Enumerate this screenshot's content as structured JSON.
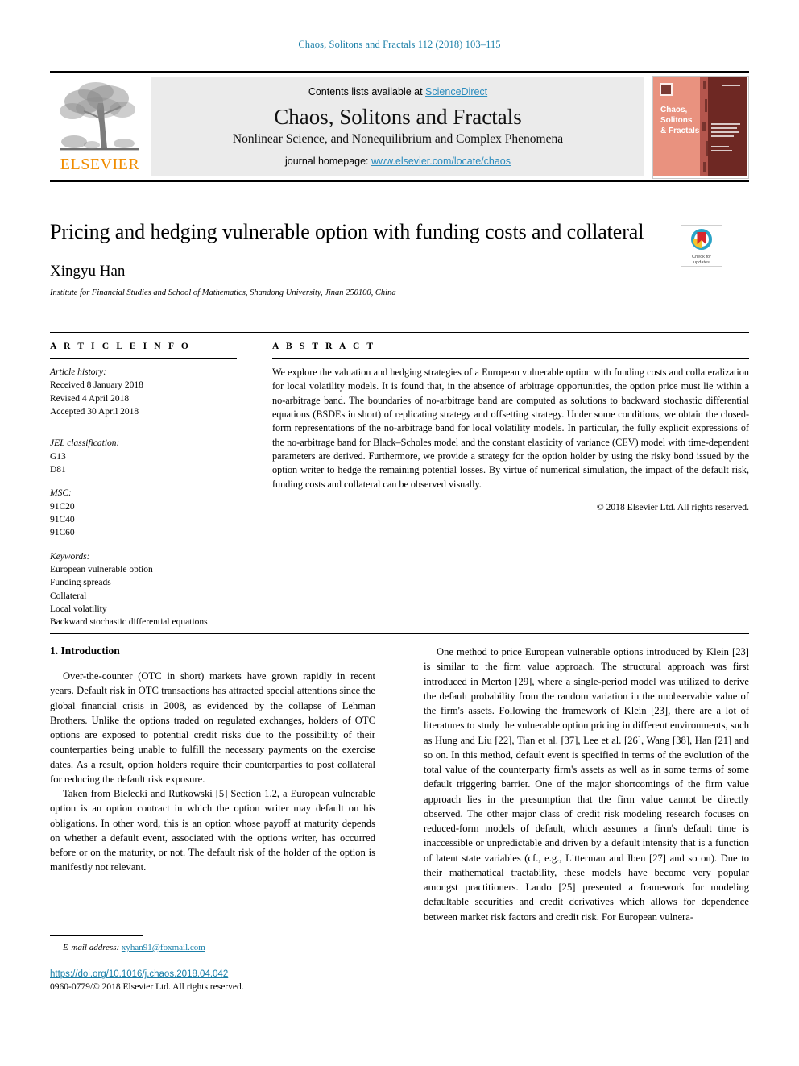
{
  "running_head": "Chaos, Solitons and Fractals 112 (2018) 103–115",
  "masthead": {
    "publisher_name": "ELSEVIER",
    "contents_prefix": "Contents lists available at ",
    "contents_link": "ScienceDirect",
    "journal_title": "Chaos, Solitons and Fractals",
    "journal_subtitle": "Nonlinear Science, and Nonequilibrium and Complex Phenomena",
    "homepage_prefix": "journal homepage: ",
    "homepage_url": "www.elsevier.com/locate/chaos",
    "cover_title_lines": [
      "Chaos,",
      "Solitons",
      "& Fractals"
    ]
  },
  "title_block": {
    "title": "Pricing and hedging vulnerable option with funding costs and collateral",
    "author": "Xingyu Han",
    "affiliation": "Institute for Financial Studies and School of Mathematics, Shandong University, Jinan 250100, China",
    "crossmark_label_line1": "Check for",
    "crossmark_label_line2": "updates"
  },
  "article_info": {
    "heading": "A R T I C L E   I N F O",
    "history_label": "Article history:",
    "history": [
      "Received 8 January 2018",
      "Revised 4 April 2018",
      "Accepted 30 April 2018"
    ],
    "jel_label": "JEL classification:",
    "jel": [
      "G13",
      "D81"
    ],
    "msc_label": "MSC:",
    "msc": [
      "91C20",
      "91C40",
      "91C60"
    ],
    "keywords_label": "Keywords:",
    "keywords": [
      "European vulnerable option",
      "Funding spreads",
      "Collateral",
      "Local volatility",
      "Backward stochastic differential equations"
    ]
  },
  "abstract": {
    "heading": "A B S T R A C T",
    "text": "We explore the valuation and hedging strategies of a European vulnerable option with funding costs and collateralization for local volatility models. It is found that, in the absence of arbitrage opportunities, the option price must lie within a no-arbitrage band. The boundaries of no-arbitrage band are computed as solutions to backward stochastic differential equations (BSDEs in short) of replicating strategy and offsetting strategy. Under some conditions, we obtain the closed-form representations of the no-arbitrage band for local volatility models. In particular, the fully explicit expressions of the no-arbitrage band for Black–Scholes model and the constant elasticity of variance (CEV) model with time-dependent parameters are derived. Furthermore, we provide a strategy for the option holder by using the risky bond issued by the option writer to hedge the remaining potential losses. By virtue of numerical simulation, the impact of the default risk, funding costs and collateral can be observed visually.",
    "copyright": "© 2018 Elsevier Ltd. All rights reserved."
  },
  "body": {
    "section_number_title": "1. Introduction",
    "left_paragraphs": [
      "Over-the-counter (OTC in short) markets have grown rapidly in recent years. Default risk in OTC transactions has attracted special attentions since the global financial crisis in 2008, as evidenced by the collapse of Lehman Brothers. Unlike the options traded on regulated exchanges, holders of OTC options are exposed to potential credit risks due to the possibility of their counterparties being unable to fulfill the necessary payments on the exercise dates. As a result, option holders require their counterparties to post collateral for reducing the default risk exposure.",
      "Taken from Bielecki and Rutkowski [5] Section 1.2, a European vulnerable option is an option contract in which the option writer may default on his obligations. In other word, this is an option whose payoff at maturity depends on whether a default event, associated with the options writer, has occurred before or on the maturity, or not. The default risk of the holder of the option is manifestly not relevant."
    ],
    "right_paragraphs": [
      "One method to price European vulnerable options introduced by Klein [23] is similar to the firm value approach. The structural approach was first introduced in Merton [29], where a single-period model was utilized to derive the default probability from the random variation in the unobservable value of the firm's assets. Following the framework of Klein [23], there are a lot of literatures to study the vulnerable option pricing in different environments, such as Hung and Liu [22], Tian et al. [37], Lee et al. [26], Wang [38], Han [21] and so on. In this method, default event is specified in terms of the evolution of the total value of the counterparty firm's assets as well as in some terms of some default triggering barrier. One of the major shortcomings of the firm value approach lies in the presumption that the firm value cannot be directly observed. The other major class of credit risk modeling research focuses on reduced-form models of default, which assumes a firm's default time is inaccessible or unpredictable and driven by a default intensity that is a function of latent state variables (cf., e.g., Litterman and Iben [27] and so on). Due to their mathematical tractability, these models have become very popular amongst practitioners. Lando [25] presented a framework for modeling defaultable securities and credit derivatives which allows for dependence between market risk factors and credit risk. For European vulnera-"
    ]
  },
  "footer": {
    "email_label": "E-mail address:",
    "email": "xyhan91@foxmail.com",
    "doi": "https://doi.org/10.1016/j.chaos.2018.04.042",
    "issn_line": "0960-0779/© 2018 Elsevier Ltd. All rights reserved."
  },
  "colors": {
    "link_blue": "#1a7fa8",
    "sd_blue": "#2b8cbe",
    "elsevier_orange": "#F08C00",
    "band_grey": "#ebebeb"
  }
}
